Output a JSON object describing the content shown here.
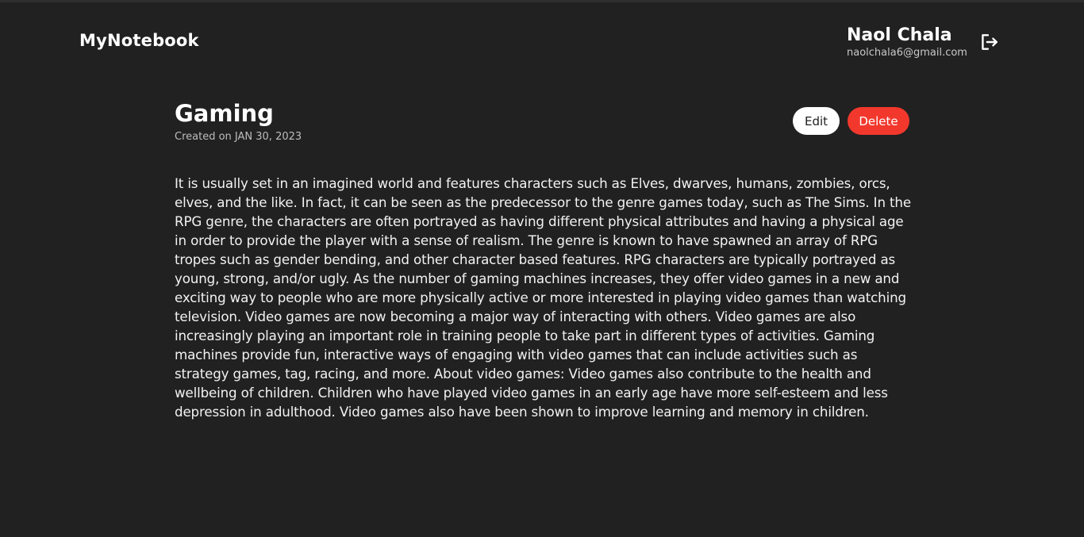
{
  "header": {
    "brand": "MyNotebook",
    "user_name": "Naol Chala",
    "user_email": "naolchala6@gmail.com",
    "logout_icon": "logout-icon"
  },
  "note": {
    "title": "Gaming",
    "created": "Created on JAN 30, 2023",
    "edit_label": "Edit",
    "delete_label": "Delete",
    "body": "It is usually set in an imagined world and features characters such as Elves, dwarves, humans, zombies, orcs, elves, and the like. In fact, it can be seen as the predecessor to the genre games today, such as The Sims. In the RPG genre, the characters are often portrayed as having different physical attributes and having a physical age in order to provide the player with a sense of realism. The genre is known to have spawned an array of RPG tropes such as gender bending, and other character based features. RPG characters are typically portrayed as young, strong, and/or ugly. As the number of gaming machines increases, they offer video games in a new and exciting way to people who are more physically active or more interested in playing video games than watching television. Video games are now becoming a major way of interacting with others. Video games are also increasingly playing an important role in training people to take part in different types of activities. Gaming machines provide fun, interactive ways of engaging with video games that can include activities such as strategy games, tag, racing, and more. About video games: Video games also contribute to the health and wellbeing of children. Children who have played video games in an early age have more self-esteem and less depression in adulthood. Video games also have been shown to improve learning and memory in children."
  },
  "colors": {
    "background": "#212121",
    "delete_accent": "#f2382d",
    "edit_button": "#ffffff"
  }
}
